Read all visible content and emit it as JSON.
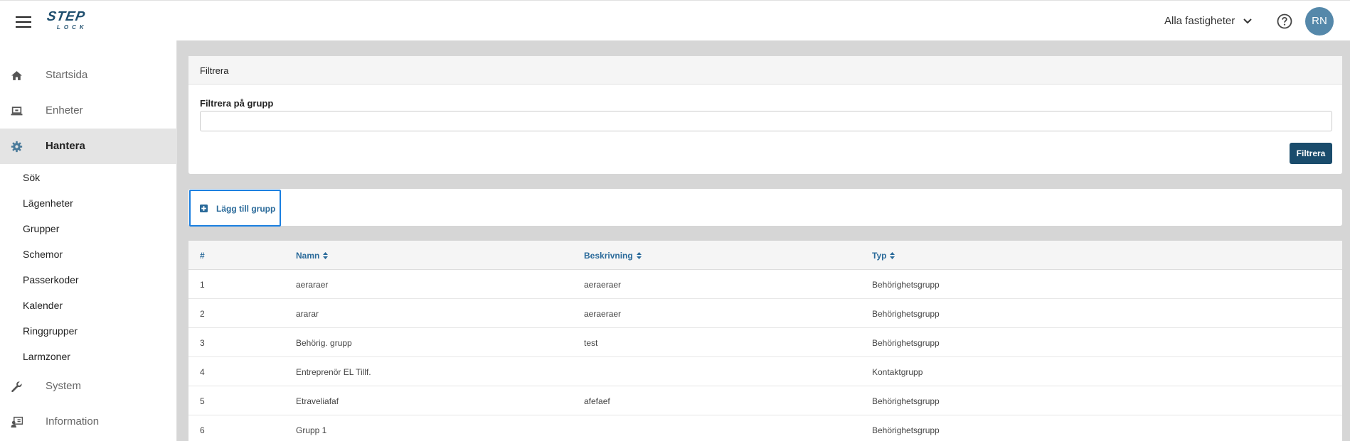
{
  "header": {
    "logo_main": "STEP",
    "logo_sub": "LOCK",
    "property_selector": "Alla fastigheter",
    "avatar_initials": "RN"
  },
  "sidebar": {
    "items": [
      {
        "label": "Startsida",
        "icon": "home-icon"
      },
      {
        "label": "Enheter",
        "icon": "laptop-icon"
      },
      {
        "label": "Hantera",
        "icon": "gear-icon",
        "active": true
      },
      {
        "label": "System",
        "icon": "wrench-icon"
      },
      {
        "label": "Information",
        "icon": "info-person-icon"
      }
    ],
    "subitems": [
      "Sök",
      "Lägenheter",
      "Grupper",
      "Schemor",
      "Passerkoder",
      "Kalender",
      "Ringgrupper",
      "Larmzoner"
    ]
  },
  "filter": {
    "title": "Filtrera",
    "field_label": "Filtrera på grupp",
    "field_value": "",
    "button_label": "Filtrera"
  },
  "add_group": {
    "label": "Lägg till grupp"
  },
  "table": {
    "headers": [
      "#",
      "Namn",
      "Beskrivning",
      "Typ"
    ],
    "rows": [
      [
        "1",
        "aeraraer",
        "aeraeraer",
        "Behörighetsgrupp"
      ],
      [
        "2",
        "ararar",
        "aeraeraer",
        "Behörighetsgrupp"
      ],
      [
        "3",
        "Behörig. grupp",
        "test",
        "Behörighetsgrupp"
      ],
      [
        "4",
        "Entreprenör EL Tillf.",
        "",
        "Kontaktgrupp"
      ],
      [
        "5",
        "Etraveliafaf",
        "afefaef",
        "Behörighetsgrupp"
      ],
      [
        "6",
        "Grupp 1",
        "",
        "Behörighetsgrupp"
      ]
    ]
  },
  "colors": {
    "accent": "#1a4c6c",
    "link": "#2a6a9a",
    "focus": "#1a7fe0",
    "avatar": "#5588aa"
  }
}
